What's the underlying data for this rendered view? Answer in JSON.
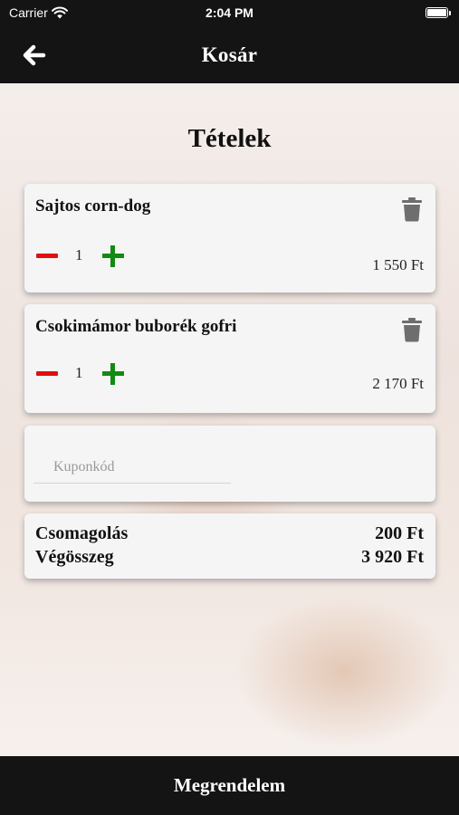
{
  "status_bar": {
    "carrier": "Carrier",
    "time": "2:04 PM"
  },
  "header": {
    "title": "Kosár",
    "back_icon": "arrow-left-icon"
  },
  "section_title": "Tételek",
  "items": [
    {
      "name": "Sajtos corn-dog",
      "quantity": "1",
      "price": "1 550 Ft"
    },
    {
      "name": "Csokimámor buborék gofri",
      "quantity": "1",
      "price": "2 170 Ft"
    }
  ],
  "coupon": {
    "placeholder": "Kuponkód",
    "value": ""
  },
  "summary": {
    "packaging_label": "Csomagolás",
    "packaging_value": "200 Ft",
    "total_label": "Végösszeg",
    "total_value": "3 920 Ft"
  },
  "footer": {
    "order_label": "Megrendelem"
  },
  "colors": {
    "bar_bg": "#141414",
    "minus": "#e01010",
    "plus": "#138a13",
    "trash": "#6e6e6e"
  }
}
